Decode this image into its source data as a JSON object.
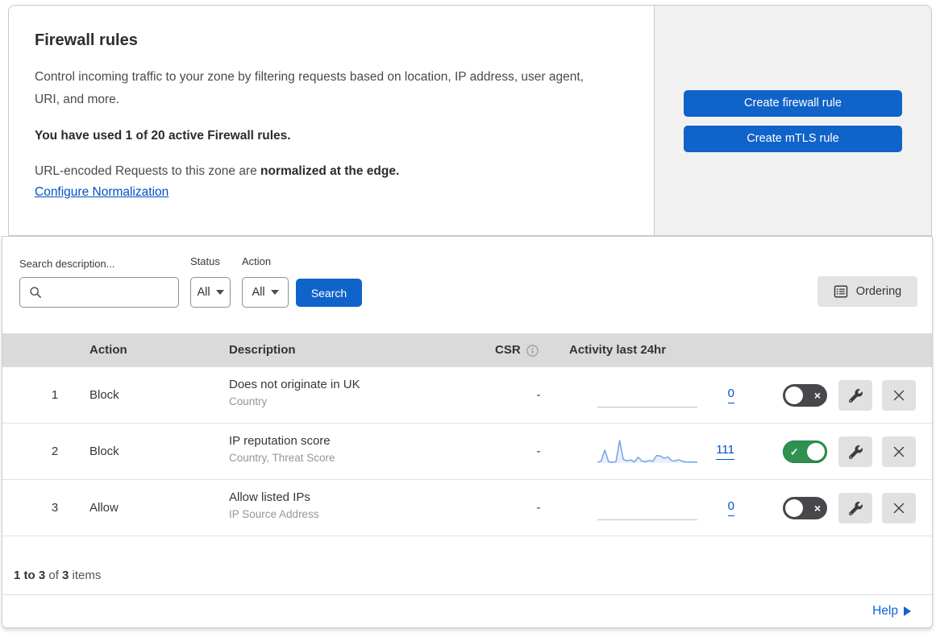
{
  "colors": {
    "accent_blue": "#1063c9",
    "link_blue": "#0051c3",
    "help_blue": "#0f62d8",
    "toggle_on_green": "#2e9150",
    "toggle_off_gray": "#48484c",
    "table_header_gray": "#dadada",
    "side_panel_gray": "#f1f1f2",
    "sparkline_blue": "#7aa7e9"
  },
  "icons": {
    "check_glyph": "✓",
    "cross_glyph": "×"
  },
  "intro": {
    "title": "Firewall rules",
    "description": "Control incoming traffic to your zone by filtering requests based on location, IP address, user agent, URI, and more.",
    "usage_bold": "You have used 1 of 20 active Firewall rules.",
    "normalization_prefix": "URL-encoded Requests to this zone are ",
    "normalization_bold": "normalized at the edge.",
    "normalization_link": "Configure Normalization"
  },
  "actions_panel": {
    "create_firewall_label": "Create firewall rule",
    "create_mtls_label": "Create mTLS rule"
  },
  "filters": {
    "search_label": "Search description...",
    "search_value": "",
    "status_label": "Status",
    "status_value": "All",
    "action_label": "Action",
    "action_value": "All",
    "search_button_label": "Search",
    "ordering_button_label": "Ordering"
  },
  "table": {
    "headers": {
      "action": "Action",
      "description": "Description",
      "csr": "CSR",
      "activity": "Activity last 24hr"
    },
    "rows": [
      {
        "num": "1",
        "action": "Block",
        "description": "Does not originate in UK",
        "criteria": "Country",
        "csr": "-",
        "activity_count": "0",
        "enabled": false,
        "sparkline": []
      },
      {
        "num": "2",
        "action": "Block",
        "description": "IP reputation score",
        "criteria": "Country, Threat Score",
        "csr": "-",
        "activity_count": "111",
        "enabled": true,
        "sparkline": [
          4,
          8,
          58,
          6,
          3,
          5,
          100,
          16,
          10,
          14,
          5,
          26,
          9,
          6,
          11,
          8,
          34,
          31,
          21,
          27,
          11,
          9,
          15,
          7,
          5,
          4,
          5,
          4
        ]
      },
      {
        "num": "3",
        "action": "Allow",
        "description": "Allow listed IPs",
        "criteria": "IP Source Address",
        "csr": "-",
        "activity_count": "0",
        "enabled": false,
        "sparkline": []
      }
    ]
  },
  "footer": {
    "range_bold": "1 to 3",
    "of_text": " of ",
    "total_bold": "3",
    "items_text": " items",
    "help_label": "Help"
  }
}
